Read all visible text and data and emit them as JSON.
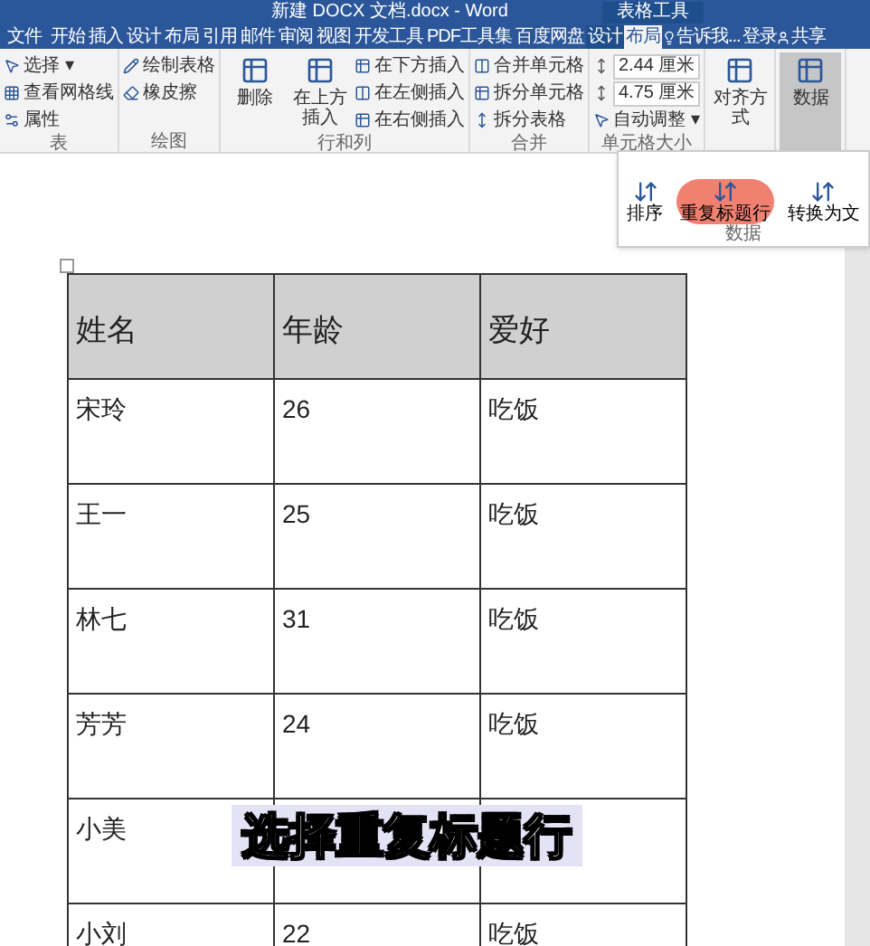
{
  "title_bar": {
    "title": "新建 DOCX 文档.docx - Word",
    "context_label": "表格工具"
  },
  "tabs": [
    {
      "label": "文件",
      "selected": false,
      "kind": "file"
    },
    {
      "label": "开始",
      "selected": false
    },
    {
      "label": "插入",
      "selected": false
    },
    {
      "label": "设计",
      "selected": false
    },
    {
      "label": "布局",
      "selected": false
    },
    {
      "label": "引用",
      "selected": false
    },
    {
      "label": "邮件",
      "selected": false
    },
    {
      "label": "审阅",
      "selected": false
    },
    {
      "label": "视图",
      "selected": false
    },
    {
      "label": "开发工具",
      "selected": false
    },
    {
      "label": "PDF工具集",
      "selected": false
    },
    {
      "label": "百度网盘",
      "selected": false
    },
    {
      "label": "设计",
      "selected": false,
      "kind": "context"
    },
    {
      "label": "布局",
      "selected": true,
      "kind": "context"
    }
  ],
  "tell_me": "告诉我...",
  "login": "登录",
  "share": "共享",
  "ribbon_groups": [
    {
      "label": "表",
      "items": [
        {
          "label": "选择 ▾",
          "kind": "small"
        },
        {
          "label": "查看网格线",
          "kind": "small"
        },
        {
          "label": "属性",
          "kind": "small"
        }
      ]
    },
    {
      "label": "绘图",
      "items": [
        {
          "label": "绘制表格",
          "kind": "small"
        },
        {
          "label": "橡皮擦",
          "kind": "small"
        }
      ]
    },
    {
      "label": "行和列",
      "items": [
        {
          "label": "删除",
          "kind": "large"
        },
        {
          "label": "在上方插入",
          "kind": "large"
        },
        {
          "label": "在下方插入",
          "kind": "small"
        },
        {
          "label": "在左侧插入",
          "kind": "small"
        },
        {
          "label": "在右侧插入",
          "kind": "small"
        }
      ]
    },
    {
      "label": "合并",
      "items": [
        {
          "label": "合并单元格",
          "kind": "small"
        },
        {
          "label": "拆分单元格",
          "kind": "small"
        },
        {
          "label": "拆分表格",
          "kind": "small"
        }
      ]
    },
    {
      "label": "单元格大小",
      "items": [
        {
          "label": "2.44 厘米",
          "kind": "field"
        },
        {
          "label": "4.75 厘米",
          "kind": "field"
        },
        {
          "label": "自动调整 ▾",
          "kind": "small"
        }
      ]
    },
    {
      "items": [
        {
          "label": "对齐方式",
          "kind": "large"
        }
      ]
    },
    {
      "items": [
        {
          "label": "数据",
          "kind": "large",
          "selected": true
        }
      ]
    }
  ],
  "data_menu": {
    "label": "数据",
    "items": [
      {
        "label": "排序",
        "selected": false
      },
      {
        "label": "重复标题行",
        "selected": true
      },
      {
        "label": "转换为文",
        "selected": false
      }
    ]
  },
  "table": {
    "columns": [
      "姓名",
      "年龄",
      "爱好"
    ],
    "rows": [
      [
        "宋玲",
        "26",
        "吃饭"
      ],
      [
        "王一",
        "25",
        "吃饭"
      ],
      [
        "林七",
        "31",
        "吃饭"
      ],
      [
        "芳芳",
        "24",
        "吃饭"
      ],
      [
        "小美",
        "",
        ""
      ],
      [
        "小刘",
        "22",
        "吃饭"
      ]
    ]
  },
  "caption": "选择重复标题行"
}
